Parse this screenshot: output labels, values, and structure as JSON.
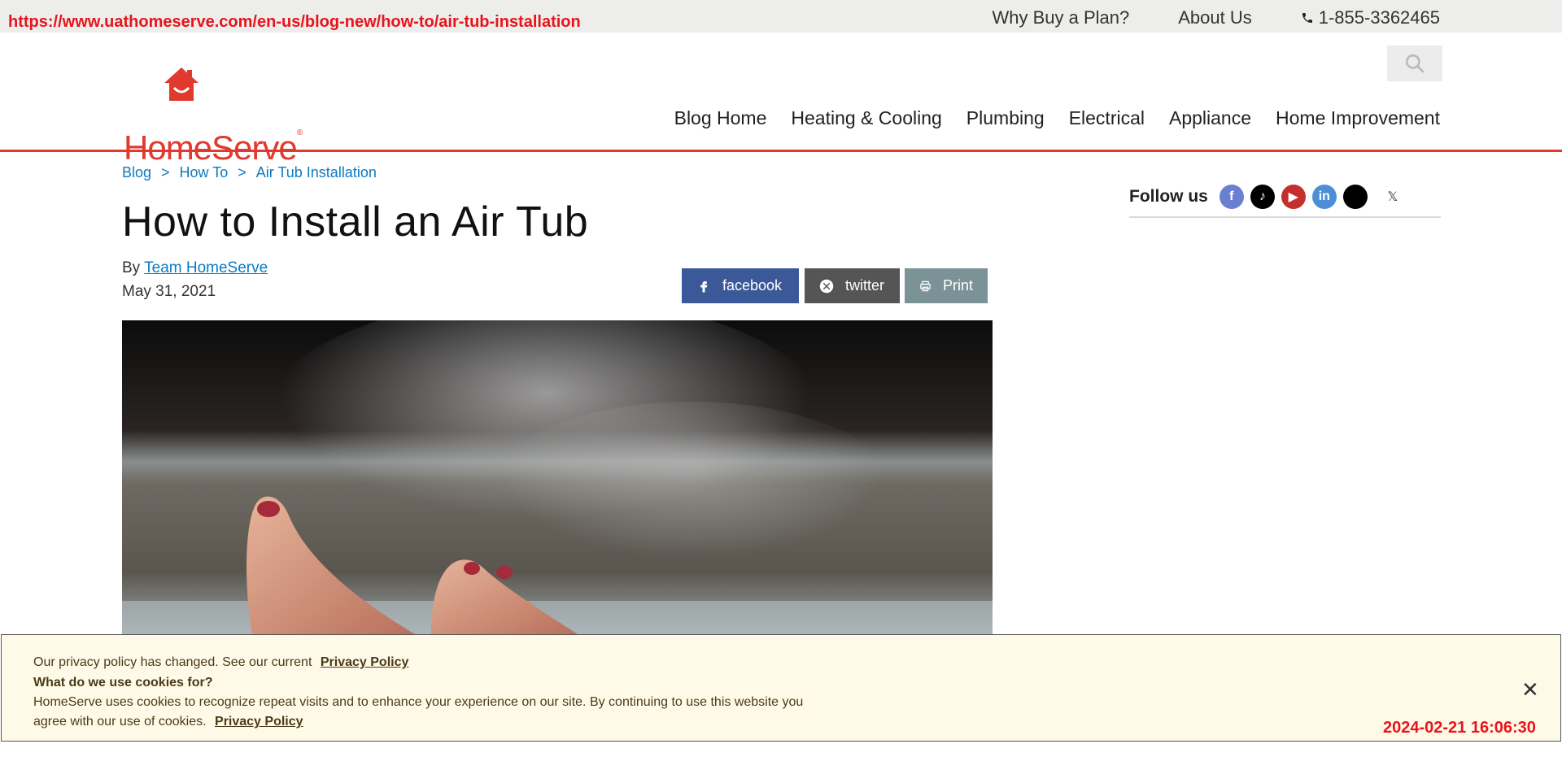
{
  "overlay": {
    "url": "https://www.uathomeserve.com/en-us/blog-new/how-to/air-tub-installation",
    "timestamp": "2024-02-21 16:06:30"
  },
  "topbar": {
    "links": [
      "Why Buy a Plan?",
      "About Us"
    ],
    "phone": "1-855-3362465"
  },
  "header": {
    "logo_text": "HomeServe",
    "logo_reg": "®",
    "nav": [
      "Blog Home",
      "Heating & Cooling",
      "Plumbing",
      "Electrical",
      "Appliance",
      "Home Improvement"
    ]
  },
  "breadcrumb": {
    "items": [
      "Blog",
      "How To",
      "Air Tub Installation"
    ],
    "separator": ">"
  },
  "article": {
    "title": "How to Install an Air Tub",
    "by_prefix": "By",
    "author": "Team HomeServe",
    "date": "May 31, 2021"
  },
  "share": {
    "facebook": "facebook",
    "twitter": "twitter",
    "print": "Print"
  },
  "follow": {
    "label": "Follow us",
    "icons": [
      "facebook-icon",
      "tiktok-icon",
      "youtube-icon",
      "linkedin-icon",
      "threads-icon",
      "x-icon"
    ],
    "x_glyph": "𝕏",
    "fb_glyph": "f",
    "tiktok_glyph": "♪",
    "youtube_glyph": "▶",
    "linkedin_glyph": "in"
  },
  "cookie": {
    "line1": "Our privacy policy has changed. See our current",
    "line1_link": "Privacy Policy",
    "line2": "What do we use cookies for?",
    "line3": "HomeServe uses cookies to recognize repeat visits and to enhance your experience on our site. By continuing to use this website you",
    "line4": "agree with our use of cookies.",
    "line4_link": "Privacy Policy",
    "close": "✕"
  },
  "colors": {
    "brand_red": "#e03a2f",
    "link_blue": "#0b7bc0",
    "facebook_blue": "#3b5998",
    "cookie_bg": "#fffae8"
  }
}
